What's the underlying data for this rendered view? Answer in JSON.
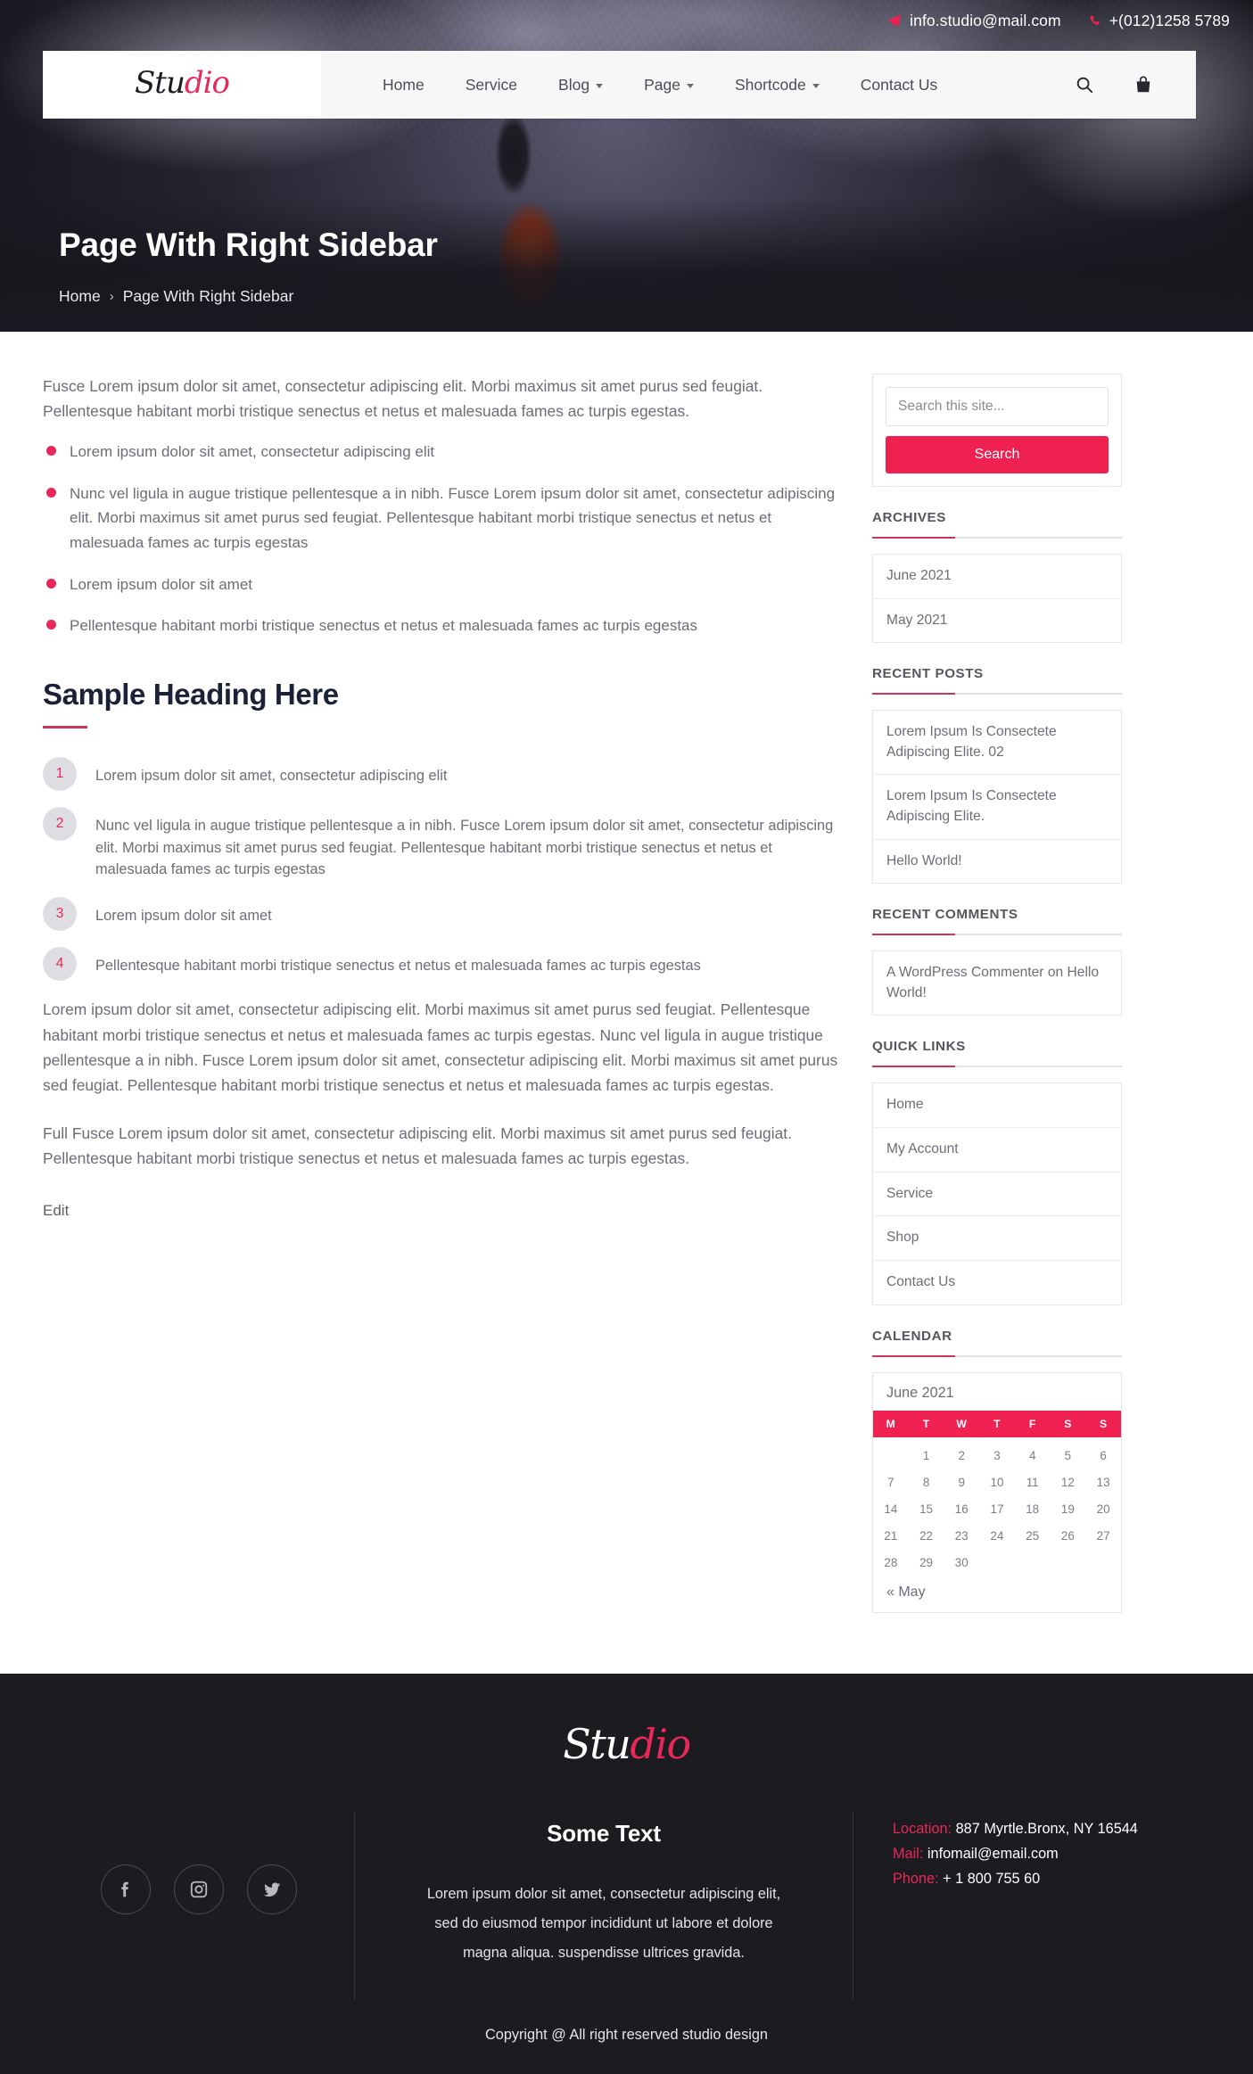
{
  "topbar": {
    "email": "info.studio@mail.com",
    "phone": "+(012)1258 5789",
    "email_icon": "send-icon",
    "phone_icon": "phone-icon"
  },
  "brand": {
    "prefix": "Stu",
    "suffix": "dio"
  },
  "nav": {
    "items": [
      {
        "label": "Home",
        "caret": false
      },
      {
        "label": "Service",
        "caret": false
      },
      {
        "label": "Blog",
        "caret": true
      },
      {
        "label": "Page",
        "caret": true
      },
      {
        "label": "Shortcode",
        "caret": true
      },
      {
        "label": "Contact Us",
        "caret": false
      }
    ],
    "tools": [
      "search-icon",
      "shopping-bag-icon"
    ]
  },
  "hero": {
    "title": "Page With Right Sidebar",
    "breadcrumb_home": "Home",
    "breadcrumb_sep": "›",
    "breadcrumb_current": "Page With Right Sidebar"
  },
  "content": {
    "intro": "Fusce Lorem ipsum dolor sit amet, consectetur adipiscing elit. Morbi maximus sit amet purus sed feugiat. Pellentesque habitant morbi tristique senectus et netus et malesuada fames ac turpis egestas.",
    "bullets": [
      "Lorem ipsum dolor sit amet, consectetur adipiscing elit",
      "Nunc vel ligula in augue tristique pellentesque a in nibh. Fusce Lorem ipsum dolor sit amet, consectetur adipiscing elit. Morbi maximus sit amet purus sed feugiat. Pellentesque habitant morbi tristique senectus et netus et malesuada fames ac turpis egestas",
      "Lorem ipsum dolor sit amet",
      "Pellentesque habitant morbi tristique senectus et netus et malesuada fames ac turpis egestas"
    ],
    "heading": "Sample Heading Here",
    "numbered": [
      {
        "n": "1",
        "text": "Lorem ipsum dolor sit amet, consectetur adipiscing elit"
      },
      {
        "n": "2",
        "text": "Nunc vel ligula in augue tristique pellentesque a in nibh. Fusce Lorem ipsum dolor sit amet, consectetur adipiscing elit. Morbi maximus sit amet purus sed feugiat. Pellentesque habitant morbi tristique senectus et netus et malesuada fames ac turpis egestas"
      },
      {
        "n": "3",
        "text": "Lorem ipsum dolor sit amet"
      },
      {
        "n": "4",
        "text": "Pellentesque habitant morbi tristique senectus et netus et malesuada fames ac turpis egestas"
      }
    ],
    "para2": "Lorem ipsum dolor sit amet, consectetur adipiscing elit. Morbi maximus sit amet purus sed feugiat. Pellentesque habitant morbi tristique senectus et netus et malesuada fames ac turpis egestas. Nunc vel ligula in augue tristique pellentesque a in nibh. Fusce Lorem ipsum dolor sit amet, consectetur adipiscing elit. Morbi maximus sit amet purus sed feugiat. Pellentesque habitant morbi tristique senectus et netus et malesuada fames ac turpis egestas.",
    "para3": "Full Fusce Lorem ipsum dolor sit amet, consectetur adipiscing elit. Morbi maximus sit amet purus sed feugiat. Pellentesque habitant morbi tristique senectus et netus et malesuada fames ac turpis egestas.",
    "edit": "Edit"
  },
  "sidebar": {
    "search": {
      "placeholder": "Search this site...",
      "value": "",
      "button": "Search"
    },
    "archives": {
      "title": "ARCHIVES",
      "items": [
        "June 2021",
        "May 2021"
      ]
    },
    "recent_posts": {
      "title": "RECENT POSTS",
      "items": [
        "Lorem Ipsum Is Consectete Adipiscing Elite. 02",
        "Lorem Ipsum Is Consectete Adipiscing Elite.",
        "Hello World!"
      ]
    },
    "recent_comments": {
      "title": "RECENT COMMENTS",
      "items": [
        "A WordPress Commenter on Hello World!"
      ]
    },
    "quick_links": {
      "title": "QUICK LINKS",
      "items": [
        "Home",
        "My Account",
        "Service",
        "Shop",
        "Contact Us"
      ]
    },
    "calendar": {
      "title": "CALENDAR",
      "caption": "June 2021",
      "day_headers": [
        "M",
        "T",
        "W",
        "T",
        "F",
        "S",
        "S"
      ],
      "weeks": [
        [
          "",
          "1",
          "2",
          "3",
          "4",
          "5",
          "6"
        ],
        [
          "7",
          "8",
          "9",
          "10",
          "11",
          "12",
          "13"
        ],
        [
          "14",
          "15",
          "16",
          "17",
          "18",
          "19",
          "20"
        ],
        [
          "21",
          "22",
          "23",
          "24",
          "25",
          "26",
          "27"
        ],
        [
          "28",
          "29",
          "30",
          "",
          "",
          "",
          ""
        ]
      ],
      "prev_link": "« May"
    }
  },
  "footer": {
    "logo_prefix": "Stu",
    "logo_suffix": "dio",
    "social": [
      "facebook-icon",
      "instagram-icon",
      "twitter-icon"
    ],
    "mid_title": "Some Text",
    "mid_text": "Lorem ipsum dolor sit amet, consectetur adipiscing elit, sed do eiusmod tempor incididunt ut labore et dolore magna aliqua. suspendisse ultrices gravida.",
    "contact": [
      {
        "label": "Location:",
        "value": "887 Myrtle.Bronx, NY 16544"
      },
      {
        "label": "Mail:",
        "value": "infomail@email.com"
      },
      {
        "label": "Phone:",
        "value": "+ 1 800 755 60"
      }
    ],
    "copyright": "Copyright @ All right reserved studio design"
  },
  "colors": {
    "accent": "#ee2151",
    "accent_dark": "#c9355d",
    "dark": "#1c1c20"
  }
}
